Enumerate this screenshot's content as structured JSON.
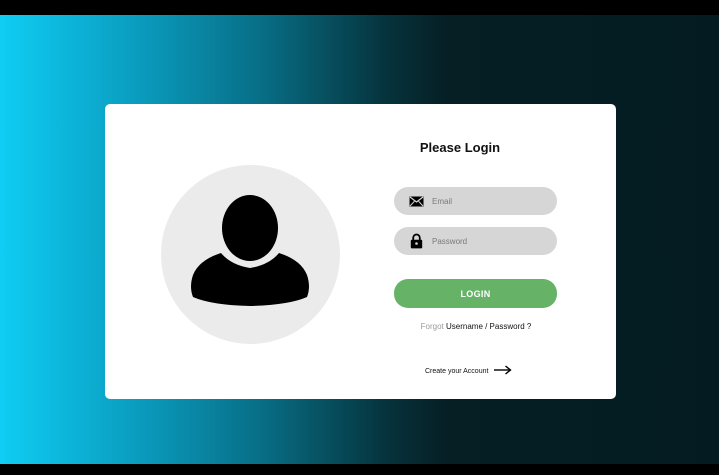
{
  "login": {
    "title": "Please Login",
    "email_placeholder": "Email",
    "password_placeholder": "Password",
    "login_label": "LOGIN",
    "forgot_prefix": "Forgot",
    "forgot_link": "Username / Password ?",
    "create_account": "Create your Account"
  },
  "icons": {
    "email": "envelope-icon",
    "password": "lock-icon",
    "avatar": "user-silhouette-icon",
    "create": "arrow-right-icon"
  },
  "colors": {
    "gradient_start": "#0fcdf3",
    "gradient_end": "#041c21",
    "card": "#ffffff",
    "field": "#d6d6d6",
    "button": "#66b368"
  }
}
